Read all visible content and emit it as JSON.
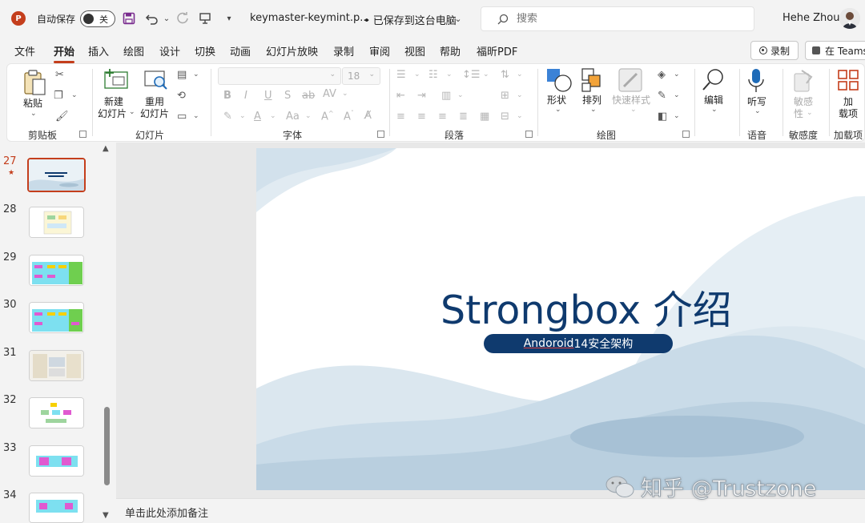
{
  "titlebar": {
    "app_logo": "P",
    "autosave_label": "自动保存",
    "autosave_state": "关",
    "file_title": "keymaster-keymint.p...",
    "save_status": "• 已保存到这台电脑",
    "search_placeholder": "搜索",
    "user_name": "Hehe Zhou"
  },
  "tabs": [
    "文件",
    "开始",
    "插入",
    "绘图",
    "设计",
    "切换",
    "动画",
    "幻灯片放映",
    "录制",
    "审阅",
    "视图",
    "帮助",
    "福昕PDF"
  ],
  "active_tab": "开始",
  "ribbon_right": {
    "record_label": "录制",
    "teams_label": "在 Teams"
  },
  "ribbon": {
    "clipboard": {
      "paste": "粘贴",
      "group": "剪贴板"
    },
    "slides": {
      "new_slide_1": "新建",
      "new_slide_2": "幻灯片",
      "reuse_1": "重用",
      "reuse_2": "幻灯片",
      "group": "幻灯片"
    },
    "font": {
      "font_size": "18",
      "group": "字体"
    },
    "paragraph": {
      "group": "段落"
    },
    "drawing": {
      "shapes": "形状",
      "arrange": "排列",
      "quick_styles": "快速样式",
      "group": "绘图"
    },
    "editing": {
      "label": "编辑"
    },
    "voice": {
      "dictate": "听写",
      "group": "语音"
    },
    "sensitivity": {
      "label_1": "敏感",
      "label_2": "性",
      "group": "敏感度"
    },
    "addins": {
      "label_1": "加",
      "label_2": "载项",
      "group": "加载项"
    }
  },
  "thumbnails": [
    {
      "number": "27",
      "star": "★",
      "active": true
    },
    {
      "number": "28"
    },
    {
      "number": "29"
    },
    {
      "number": "30"
    },
    {
      "number": "31"
    },
    {
      "number": "32"
    },
    {
      "number": "33"
    },
    {
      "number": "34"
    }
  ],
  "slide": {
    "title": "Strongbox 介绍",
    "subtitle_underlined": "Andoroid",
    "subtitle_rest": " 14安全架构"
  },
  "notes_placeholder": "单击此处添加备注",
  "watermark": "知乎 @Trustzone",
  "colors": {
    "accent": "#c43e1c",
    "slide_blue": "#0f3a6e",
    "wave": "#c9dbe8"
  }
}
